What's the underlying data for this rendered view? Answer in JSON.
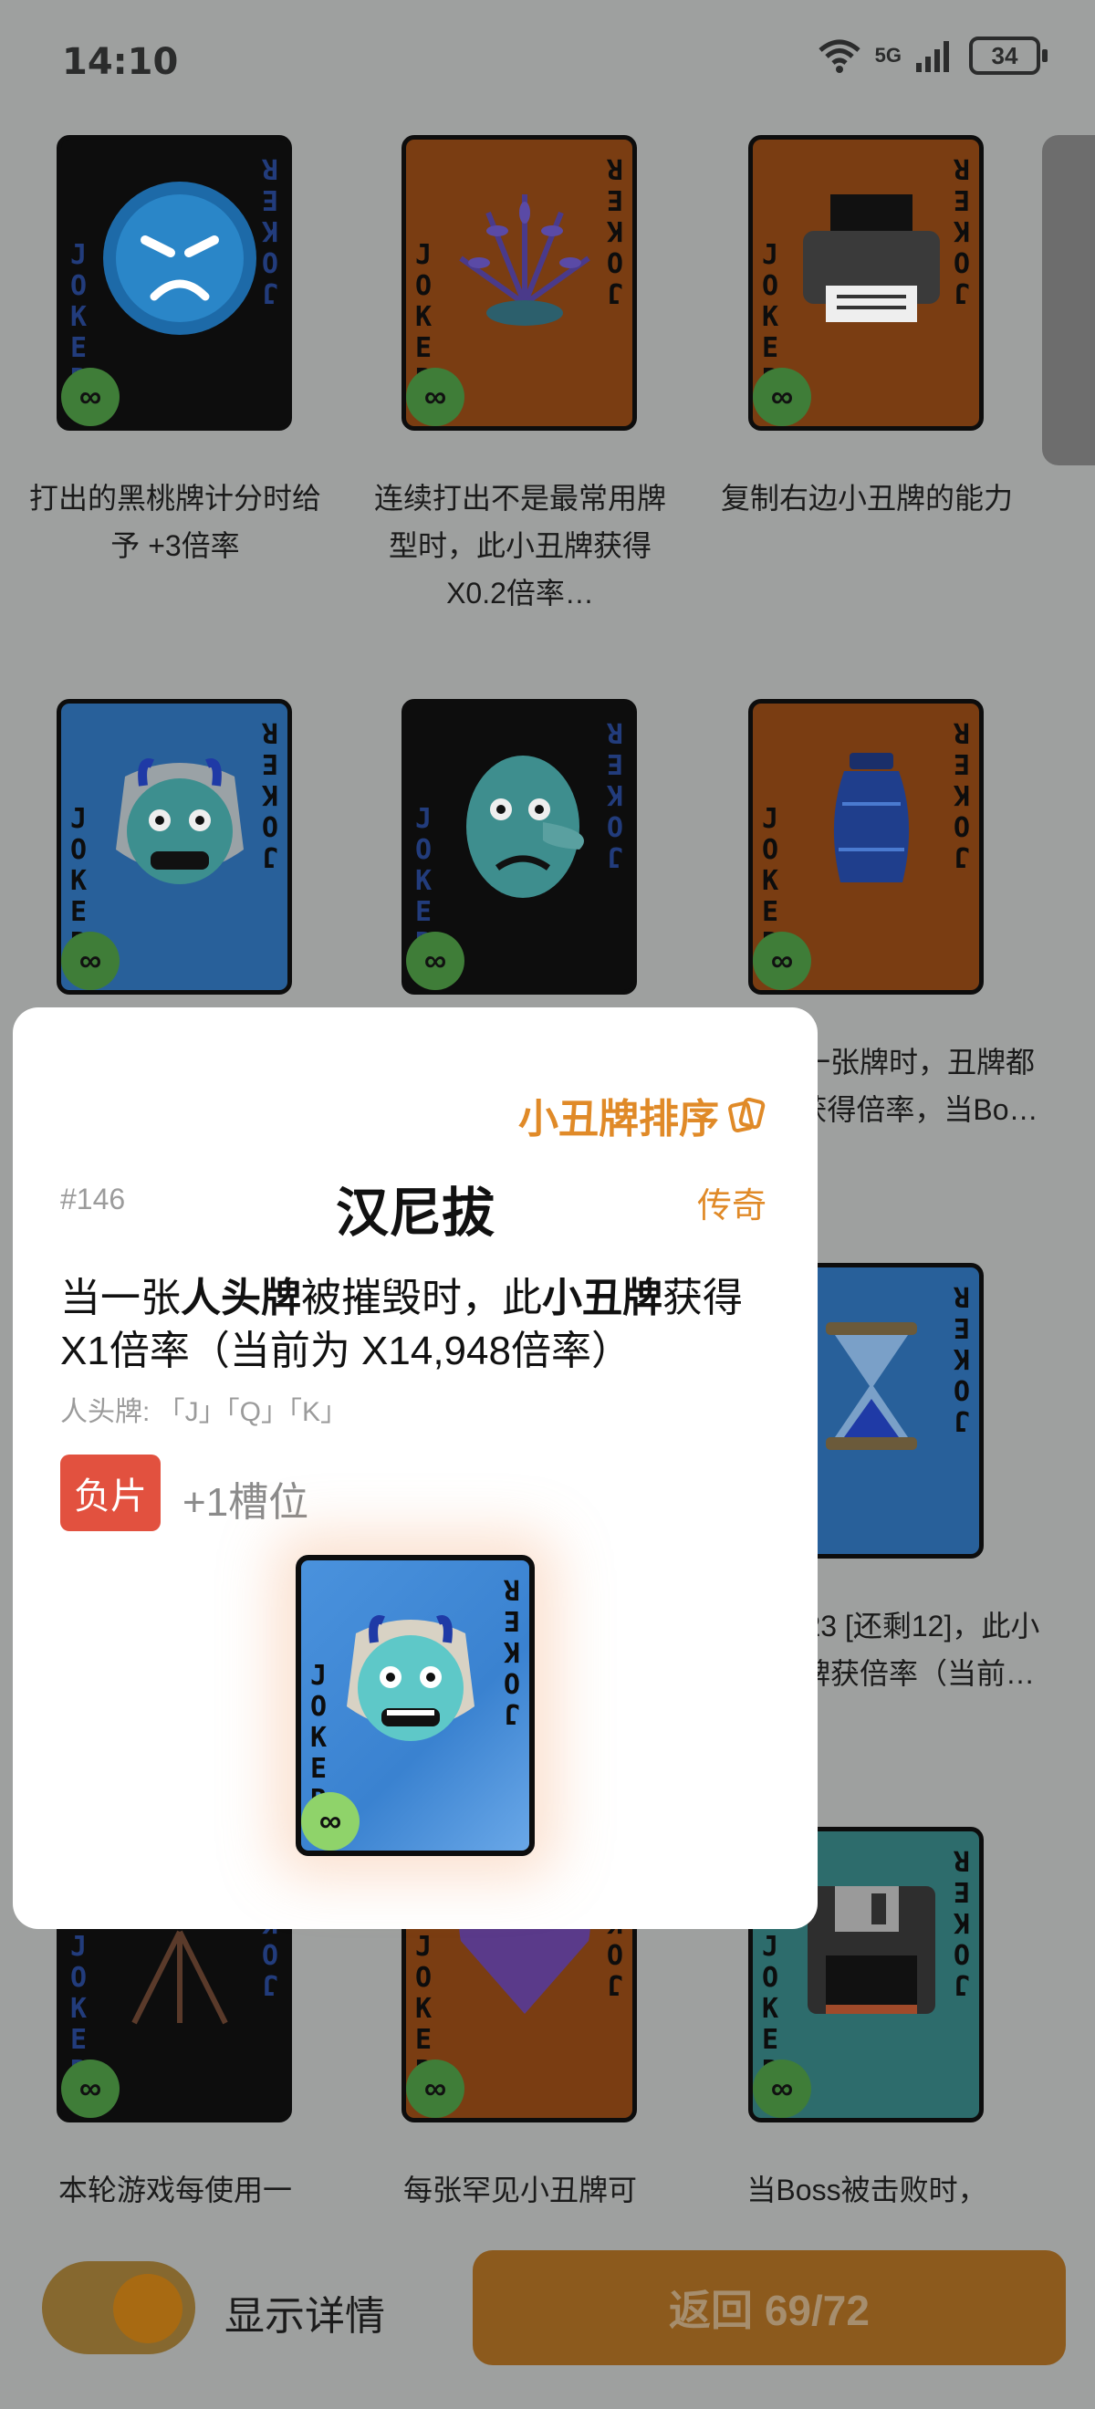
{
  "status_bar": {
    "time": "14:10",
    "network": "5G",
    "battery": "34"
  },
  "grid": {
    "cards": [
      {
        "desc": "打出的黑桃牌计分时给予 +3倍率",
        "art": "angry-face-icon",
        "bg": "black"
      },
      {
        "desc": "连续打出不是最常用牌型时，此小丑牌获得 X0.2倍率…",
        "art": "potted-fern-icon",
        "bg": "orange"
      },
      {
        "desc": "复制右边小丑牌的能力",
        "art": "printer-icon",
        "bg": "orange"
      },
      {
        "desc": "",
        "art": "ogre-mask-icon",
        "bg": "blue"
      },
      {
        "desc": "",
        "art": "tengu-mask-icon",
        "bg": "black"
      },
      {
        "desc": "出一张牌时，丑牌都会获得倍率，当Bo…",
        "art": "urn-icon",
        "bg": "orange"
      },
      {
        "desc": "",
        "art": "",
        "bg": ""
      },
      {
        "desc": "",
        "art": "",
        "bg": ""
      },
      {
        "desc": "章 23 [还剩12]，此小丑牌获倍率（当前…",
        "art": "hourglass-icon",
        "bg": "blue"
      },
      {
        "desc": "本轮游戏每使用一",
        "art": "telescope-icon",
        "bg": "black"
      },
      {
        "desc": "每张罕见小丑牌可",
        "art": "purple-heart-icon",
        "bg": "orange"
      },
      {
        "desc": "当Boss被击败时，",
        "art": "floppy-disk-icon",
        "bg": "teal"
      }
    ],
    "card_letters": "JOKER",
    "infinity_badge": "∞"
  },
  "panel": {
    "sort_link": "小丑牌排序",
    "number": "#146",
    "title": "汉尼拔",
    "rarity": "传奇",
    "effect": {
      "p1": "当一张",
      "b1": "人头牌",
      "p2": "被摧毁时，此",
      "b2": "小丑牌",
      "p3": "获得X1倍率（当前为 X14,948倍率）"
    },
    "note": "人头牌: 「J」「Q」「K」",
    "edition_badge": "负片",
    "slot_text": "+1槽位",
    "card_art": "ogre-mask-icon"
  },
  "bottom": {
    "toggle_label": "显示详情",
    "back_button": "返回 69/72"
  },
  "colors": {
    "accent": "#e08a28",
    "negative_badge": "#e2513f",
    "back_button": "#8c5a1d"
  }
}
